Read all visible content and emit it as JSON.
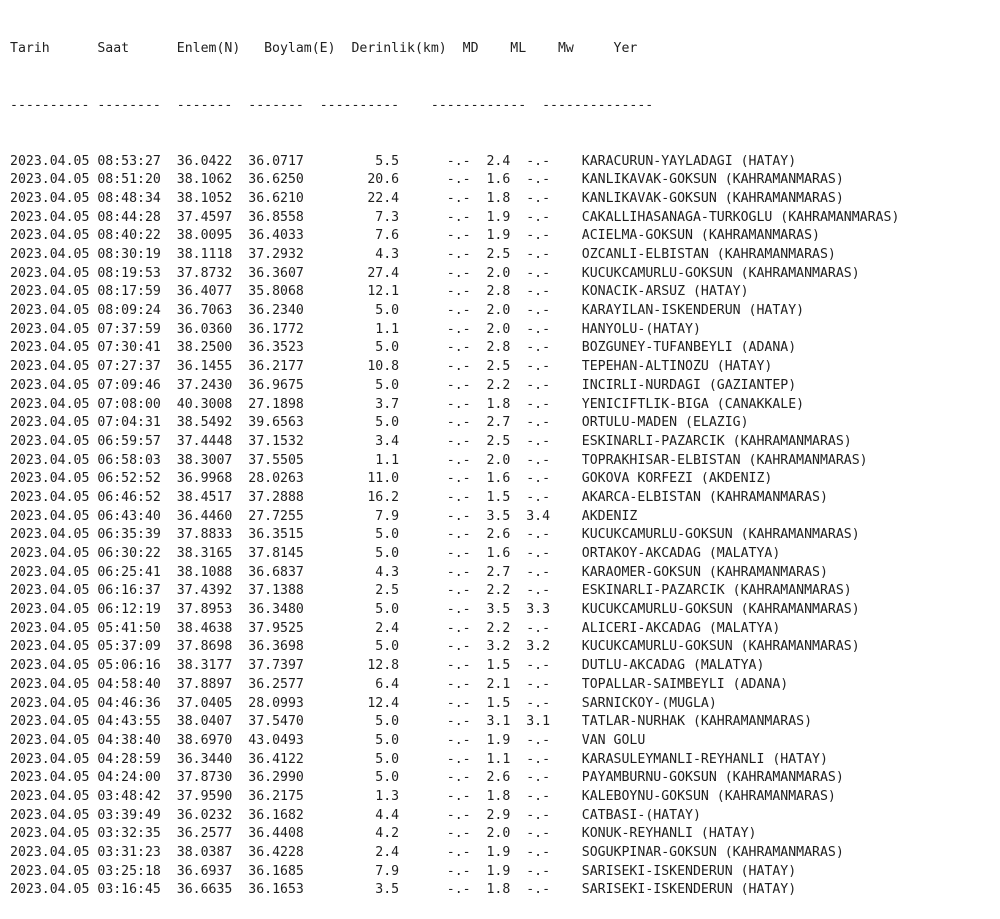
{
  "headers": {
    "tarih": "Tarih",
    "saat": "Saat",
    "enlem": "Enlem(N)",
    "boylam": "Boylam(E)",
    "derinlik": "Derinlik(km)",
    "md": "MD",
    "ml": "ML",
    "mw": "Mw",
    "yer": "Yer"
  },
  "separators": {
    "tarih": "----------",
    "saat": "--------",
    "enlem": "-------",
    "boylam": "-------",
    "derinlik": "----------",
    "magnitudes": "------------",
    "yer": "--------------"
  },
  "rows": [
    {
      "date": "2023.04.05",
      "time": "08:53:27",
      "lat": "36.0422",
      "lon": "36.0717",
      "depth": "5.5",
      "md": "-.-",
      "ml": "2.4",
      "mw": "-.-",
      "place": "KARACURUN-YAYLADAGI (HATAY)"
    },
    {
      "date": "2023.04.05",
      "time": "08:51:20",
      "lat": "38.1062",
      "lon": "36.6250",
      "depth": "20.6",
      "md": "-.-",
      "ml": "1.6",
      "mw": "-.-",
      "place": "KANLIKAVAK-GOKSUN (KAHRAMANMARAS)"
    },
    {
      "date": "2023.04.05",
      "time": "08:48:34",
      "lat": "38.1052",
      "lon": "36.6210",
      "depth": "22.4",
      "md": "-.-",
      "ml": "1.8",
      "mw": "-.-",
      "place": "KANLIKAVAK-GOKSUN (KAHRAMANMARAS)"
    },
    {
      "date": "2023.04.05",
      "time": "08:44:28",
      "lat": "37.4597",
      "lon": "36.8558",
      "depth": "7.3",
      "md": "-.-",
      "ml": "1.9",
      "mw": "-.-",
      "place": "CAKALLIHASANAGA-TURKOGLU (KAHRAMANMARAS)"
    },
    {
      "date": "2023.04.05",
      "time": "08:40:22",
      "lat": "38.0095",
      "lon": "36.4033",
      "depth": "7.6",
      "md": "-.-",
      "ml": "1.9",
      "mw": "-.-",
      "place": "ACIELMA-GOKSUN (KAHRAMANMARAS)"
    },
    {
      "date": "2023.04.05",
      "time": "08:30:19",
      "lat": "38.1118",
      "lon": "37.2932",
      "depth": "4.3",
      "md": "-.-",
      "ml": "2.5",
      "mw": "-.-",
      "place": "OZCANLI-ELBISTAN (KAHRAMANMARAS)"
    },
    {
      "date": "2023.04.05",
      "time": "08:19:53",
      "lat": "37.8732",
      "lon": "36.3607",
      "depth": "27.4",
      "md": "-.-",
      "ml": "2.0",
      "mw": "-.-",
      "place": "KUCUKCAMURLU-GOKSUN (KAHRAMANMARAS)"
    },
    {
      "date": "2023.04.05",
      "time": "08:17:59",
      "lat": "36.4077",
      "lon": "35.8068",
      "depth": "12.1",
      "md": "-.-",
      "ml": "2.8",
      "mw": "-.-",
      "place": "KONACIK-ARSUZ (HATAY)"
    },
    {
      "date": "2023.04.05",
      "time": "08:09:24",
      "lat": "36.7063",
      "lon": "36.2340",
      "depth": "5.0",
      "md": "-.-",
      "ml": "2.0",
      "mw": "-.-",
      "place": "KARAYILAN-ISKENDERUN (HATAY)"
    },
    {
      "date": "2023.04.05",
      "time": "07:37:59",
      "lat": "36.0360",
      "lon": "36.1772",
      "depth": "1.1",
      "md": "-.-",
      "ml": "2.0",
      "mw": "-.-",
      "place": "HANYOLU-(HATAY)"
    },
    {
      "date": "2023.04.05",
      "time": "07:30:41",
      "lat": "38.2500",
      "lon": "36.3523",
      "depth": "5.0",
      "md": "-.-",
      "ml": "2.8",
      "mw": "-.-",
      "place": "BOZGUNEY-TUFANBEYLI (ADANA)"
    },
    {
      "date": "2023.04.05",
      "time": "07:27:37",
      "lat": "36.1455",
      "lon": "36.2177",
      "depth": "10.8",
      "md": "-.-",
      "ml": "2.5",
      "mw": "-.-",
      "place": "TEPEHAN-ALTINOZU (HATAY)"
    },
    {
      "date": "2023.04.05",
      "time": "07:09:46",
      "lat": "37.2430",
      "lon": "36.9675",
      "depth": "5.0",
      "md": "-.-",
      "ml": "2.2",
      "mw": "-.-",
      "place": "INCIRLI-NURDAGI (GAZIANTEP)"
    },
    {
      "date": "2023.04.05",
      "time": "07:08:00",
      "lat": "40.3008",
      "lon": "27.1898",
      "depth": "3.7",
      "md": "-.-",
      "ml": "1.8",
      "mw": "-.-",
      "place": "YENICIFTLIK-BIGA (CANAKKALE)"
    },
    {
      "date": "2023.04.05",
      "time": "07:04:31",
      "lat": "38.5492",
      "lon": "39.6563",
      "depth": "5.0",
      "md": "-.-",
      "ml": "2.7",
      "mw": "-.-",
      "place": "ORTULU-MADEN (ELAZIG)"
    },
    {
      "date": "2023.04.05",
      "time": "06:59:57",
      "lat": "37.4448",
      "lon": "37.1532",
      "depth": "3.4",
      "md": "-.-",
      "ml": "2.5",
      "mw": "-.-",
      "place": "ESKINARLI-PAZARCIK (KAHRAMANMARAS)"
    },
    {
      "date": "2023.04.05",
      "time": "06:58:03",
      "lat": "38.3007",
      "lon": "37.5505",
      "depth": "1.1",
      "md": "-.-",
      "ml": "2.0",
      "mw": "-.-",
      "place": "TOPRAKHISAR-ELBISTAN (KAHRAMANMARAS)"
    },
    {
      "date": "2023.04.05",
      "time": "06:52:52",
      "lat": "36.9968",
      "lon": "28.0263",
      "depth": "11.0",
      "md": "-.-",
      "ml": "1.6",
      "mw": "-.-",
      "place": "GOKOVA KORFEZI (AKDENIZ)"
    },
    {
      "date": "2023.04.05",
      "time": "06:46:52",
      "lat": "38.4517",
      "lon": "37.2888",
      "depth": "16.2",
      "md": "-.-",
      "ml": "1.5",
      "mw": "-.-",
      "place": "AKARCA-ELBISTAN (KAHRAMANMARAS)"
    },
    {
      "date": "2023.04.05",
      "time": "06:43:40",
      "lat": "36.4460",
      "lon": "27.7255",
      "depth": "7.9",
      "md": "-.-",
      "ml": "3.5",
      "mw": "3.4",
      "place": "AKDENIZ"
    },
    {
      "date": "2023.04.05",
      "time": "06:35:39",
      "lat": "37.8833",
      "lon": "36.3515",
      "depth": "5.0",
      "md": "-.-",
      "ml": "2.6",
      "mw": "-.-",
      "place": "KUCUKCAMURLU-GOKSUN (KAHRAMANMARAS)"
    },
    {
      "date": "2023.04.05",
      "time": "06:30:22",
      "lat": "38.3165",
      "lon": "37.8145",
      "depth": "5.0",
      "md": "-.-",
      "ml": "1.6",
      "mw": "-.-",
      "place": "ORTAKOY-AKCADAG (MALATYA)"
    },
    {
      "date": "2023.04.05",
      "time": "06:25:41",
      "lat": "38.1088",
      "lon": "36.6837",
      "depth": "4.3",
      "md": "-.-",
      "ml": "2.7",
      "mw": "-.-",
      "place": "KARAOMER-GOKSUN (KAHRAMANMARAS)"
    },
    {
      "date": "2023.04.05",
      "time": "06:16:37",
      "lat": "37.4392",
      "lon": "37.1388",
      "depth": "2.5",
      "md": "-.-",
      "ml": "2.2",
      "mw": "-.-",
      "place": "ESKINARLI-PAZARCIK (KAHRAMANMARAS)"
    },
    {
      "date": "2023.04.05",
      "time": "06:12:19",
      "lat": "37.8953",
      "lon": "36.3480",
      "depth": "5.0",
      "md": "-.-",
      "ml": "3.5",
      "mw": "3.3",
      "place": "KUCUKCAMURLU-GOKSUN (KAHRAMANMARAS)"
    },
    {
      "date": "2023.04.05",
      "time": "05:41:50",
      "lat": "38.4638",
      "lon": "37.9525",
      "depth": "2.4",
      "md": "-.-",
      "ml": "2.2",
      "mw": "-.-",
      "place": "ALICERI-AKCADAG (MALATYA)"
    },
    {
      "date": "2023.04.05",
      "time": "05:37:09",
      "lat": "37.8698",
      "lon": "36.3698",
      "depth": "5.0",
      "md": "-.-",
      "ml": "3.2",
      "mw": "3.2",
      "place": "KUCUKCAMURLU-GOKSUN (KAHRAMANMARAS)"
    },
    {
      "date": "2023.04.05",
      "time": "05:06:16",
      "lat": "38.3177",
      "lon": "37.7397",
      "depth": "12.8",
      "md": "-.-",
      "ml": "1.5",
      "mw": "-.-",
      "place": "DUTLU-AKCADAG (MALATYA)"
    },
    {
      "date": "2023.04.05",
      "time": "04:58:40",
      "lat": "37.8897",
      "lon": "36.2577",
      "depth": "6.4",
      "md": "-.-",
      "ml": "2.1",
      "mw": "-.-",
      "place": "TOPALLAR-SAIMBEYLI (ADANA)"
    },
    {
      "date": "2023.04.05",
      "time": "04:46:36",
      "lat": "37.0405",
      "lon": "28.0993",
      "depth": "12.4",
      "md": "-.-",
      "ml": "1.5",
      "mw": "-.-",
      "place": "SARNICKOY-(MUGLA)"
    },
    {
      "date": "2023.04.05",
      "time": "04:43:55",
      "lat": "38.0407",
      "lon": "37.5470",
      "depth": "5.0",
      "md": "-.-",
      "ml": "3.1",
      "mw": "3.1",
      "place": "TATLAR-NURHAK (KAHRAMANMARAS)"
    },
    {
      "date": "2023.04.05",
      "time": "04:38:40",
      "lat": "38.6970",
      "lon": "43.0493",
      "depth": "5.0",
      "md": "-.-",
      "ml": "1.9",
      "mw": "-.-",
      "place": "VAN GOLU"
    },
    {
      "date": "2023.04.05",
      "time": "04:28:59",
      "lat": "36.3440",
      "lon": "36.4122",
      "depth": "5.0",
      "md": "-.-",
      "ml": "1.1",
      "mw": "-.-",
      "place": "KARASULEYMANLI-REYHANLI (HATAY)"
    },
    {
      "date": "2023.04.05",
      "time": "04:24:00",
      "lat": "37.8730",
      "lon": "36.2990",
      "depth": "5.0",
      "md": "-.-",
      "ml": "2.6",
      "mw": "-.-",
      "place": "PAYAMBURNU-GOKSUN (KAHRAMANMARAS)"
    },
    {
      "date": "2023.04.05",
      "time": "03:48:42",
      "lat": "37.9590",
      "lon": "36.2175",
      "depth": "1.3",
      "md": "-.-",
      "ml": "1.8",
      "mw": "-.-",
      "place": "KALEBOYNU-GOKSUN (KAHRAMANMARAS)"
    },
    {
      "date": "2023.04.05",
      "time": "03:39:49",
      "lat": "36.0232",
      "lon": "36.1682",
      "depth": "4.4",
      "md": "-.-",
      "ml": "2.9",
      "mw": "-.-",
      "place": "CATBASI-(HATAY)"
    },
    {
      "date": "2023.04.05",
      "time": "03:32:35",
      "lat": "36.2577",
      "lon": "36.4408",
      "depth": "4.2",
      "md": "-.-",
      "ml": "2.0",
      "mw": "-.-",
      "place": "KONUK-REYHANLI (HATAY)"
    },
    {
      "date": "2023.04.05",
      "time": "03:31:23",
      "lat": "38.0387",
      "lon": "36.4228",
      "depth": "2.4",
      "md": "-.-",
      "ml": "1.9",
      "mw": "-.-",
      "place": "SOGUKPINAR-GOKSUN (KAHRAMANMARAS)"
    },
    {
      "date": "2023.04.05",
      "time": "03:25:18",
      "lat": "36.6937",
      "lon": "36.1685",
      "depth": "7.9",
      "md": "-.-",
      "ml": "1.9",
      "mw": "-.-",
      "place": "SARISEKI-ISKENDERUN (HATAY)"
    },
    {
      "date": "2023.04.05",
      "time": "03:16:45",
      "lat": "36.6635",
      "lon": "36.1653",
      "depth": "3.5",
      "md": "-.-",
      "ml": "1.8",
      "mw": "-.-",
      "place": "SARISEKI-ISKENDERUN (HATAY)"
    }
  ]
}
